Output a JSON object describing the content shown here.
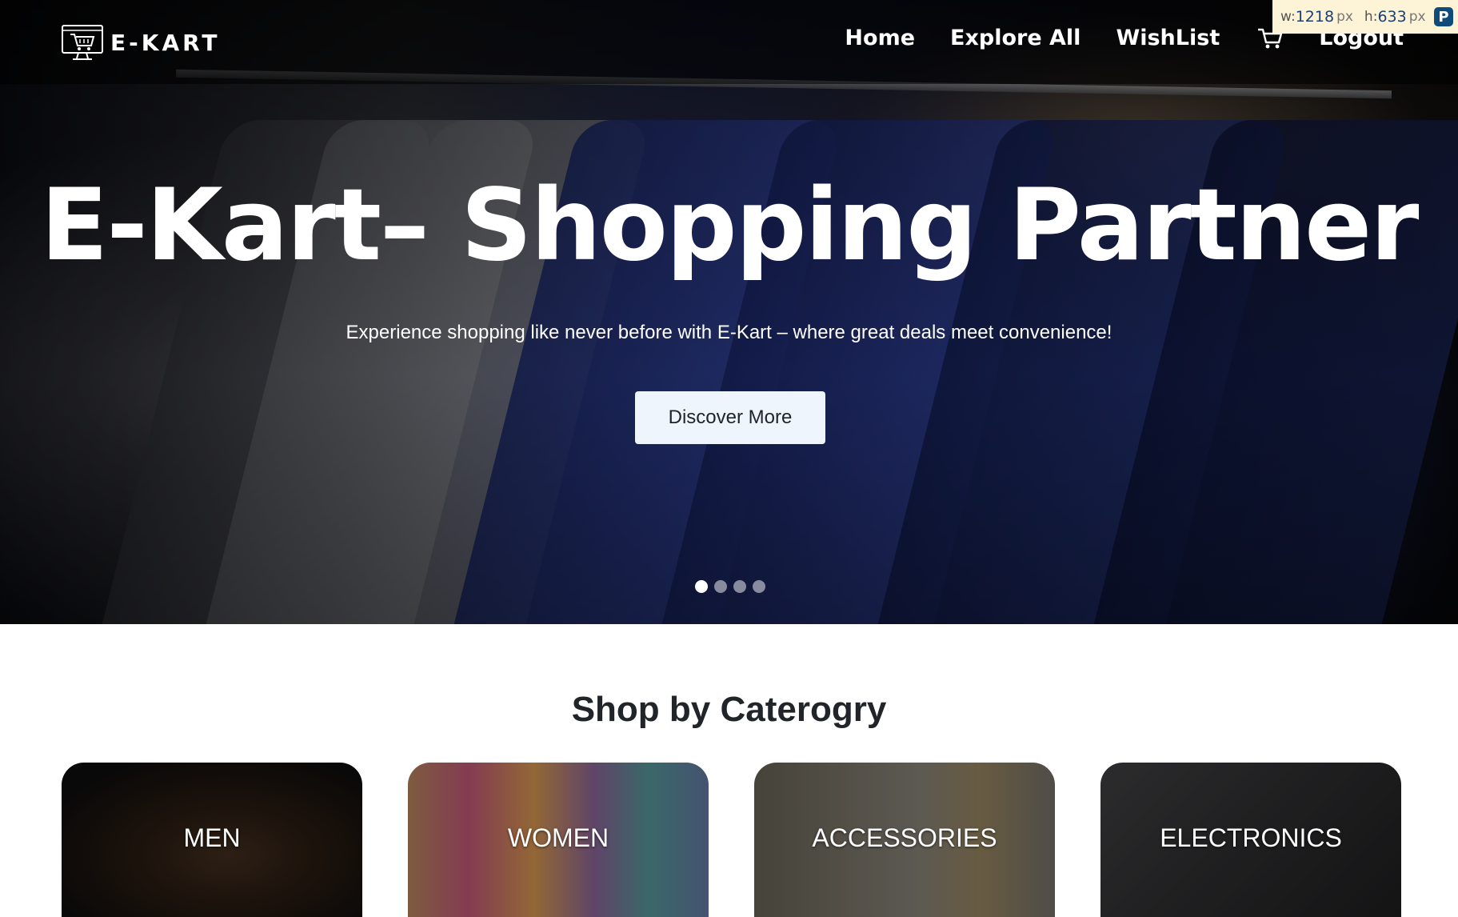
{
  "brand": {
    "name": "E-KART"
  },
  "nav": {
    "items": [
      {
        "label": "Home"
      },
      {
        "label": "Explore All"
      },
      {
        "label": "WishList"
      },
      {
        "label": "Logout"
      }
    ],
    "cart_icon": "cart-icon"
  },
  "dims_overlay": {
    "w_label": "w:",
    "w_value": "1218",
    "h_label": "h:",
    "h_value": "633",
    "unit": "px",
    "badge": "P"
  },
  "hero": {
    "title": "E-Kart– Shopping Partner",
    "subtitle": "Experience shopping like never before with E-Kart – where great deals meet convenience!",
    "cta_label": "Discover More",
    "slides": 4,
    "active_slide": 1
  },
  "categories_section": {
    "title": "Shop by Caterogry",
    "items": [
      {
        "label": "MEN"
      },
      {
        "label": "WOMEN"
      },
      {
        "label": "ACCESSORIES"
      },
      {
        "label": "ELECTRONICS"
      }
    ]
  },
  "colors": {
    "cta_bg": "#eef5fd",
    "text_dark": "#212529",
    "white": "#ffffff"
  }
}
